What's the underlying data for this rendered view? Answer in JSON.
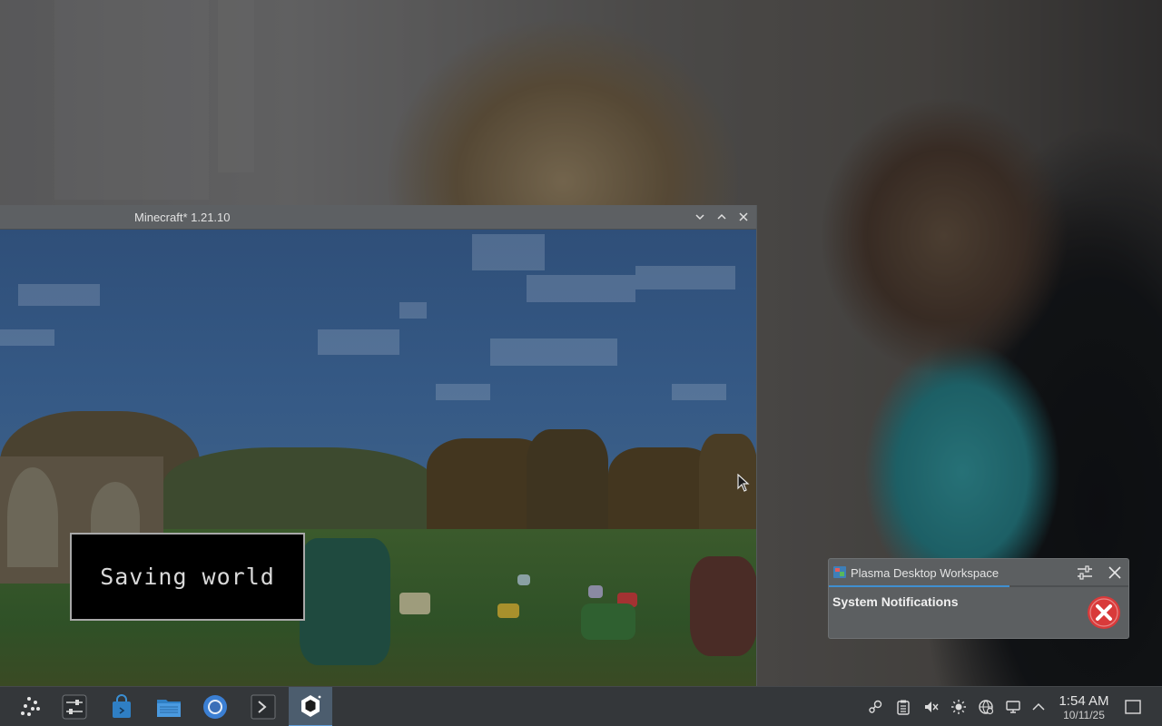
{
  "minecraft_window": {
    "title": "Minecraft* 1.21.10",
    "saving_message": "Saving world"
  },
  "notification": {
    "app_name": "Plasma Desktop Workspace",
    "summary": "System Notifications",
    "progress": 0.6,
    "icon": "error-icon"
  },
  "taskbar": {
    "launchers": [
      {
        "name": "application-launcher",
        "icon": "kde-launcher-icon"
      },
      {
        "name": "system-settings",
        "icon": "settings-sliders-icon"
      },
      {
        "name": "discover-store",
        "icon": "store-bag-icon"
      },
      {
        "name": "file-manager",
        "icon": "folder-icon"
      },
      {
        "name": "web-browser",
        "icon": "chromium-icon"
      },
      {
        "name": "terminal",
        "icon": "terminal-icon"
      },
      {
        "name": "minecraft-launcher",
        "icon": "minecraft-hexagon-icon",
        "active": true
      }
    ],
    "tray": [
      "steam-icon",
      "clipboard-icon",
      "volume-muted-icon",
      "brightness-icon",
      "network-icon",
      "display-icon",
      "expand-tray-icon"
    ],
    "clock": {
      "time": "1:54 AM",
      "date": "10/11/25"
    }
  },
  "colors": {
    "accent": "#3f8fd0",
    "error": "#d93a3a",
    "taskbar": "#34373a"
  }
}
